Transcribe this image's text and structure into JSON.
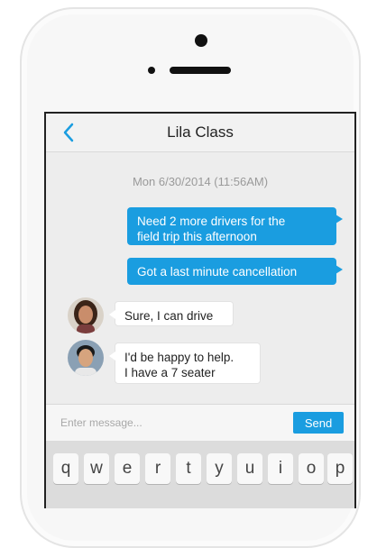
{
  "conversation": {
    "title": "Lila Class",
    "timestamp": "Mon 6/30/2014 (11:56AM)"
  },
  "messages": [
    {
      "direction": "outgoing",
      "lines": [
        "Need 2 more drivers for the",
        "field trip this afternoon"
      ]
    },
    {
      "direction": "outgoing",
      "lines": [
        "Got a last minute cancellation"
      ]
    },
    {
      "direction": "incoming",
      "lines": [
        "Sure, I can drive"
      ]
    },
    {
      "direction": "incoming",
      "lines": [
        "I'd be happy to help.",
        "I have a 7 seater"
      ]
    }
  ],
  "composer": {
    "placeholder": "Enter message...",
    "send_label": "Send"
  },
  "keyboard": {
    "row1": [
      "q",
      "w",
      "e",
      "r",
      "t",
      "y",
      "u",
      "i",
      "o",
      "p"
    ]
  },
  "colors": {
    "accent": "#1a9de0",
    "chat_background": "#ededed"
  },
  "icons": {
    "back": "chevron-left-icon"
  }
}
